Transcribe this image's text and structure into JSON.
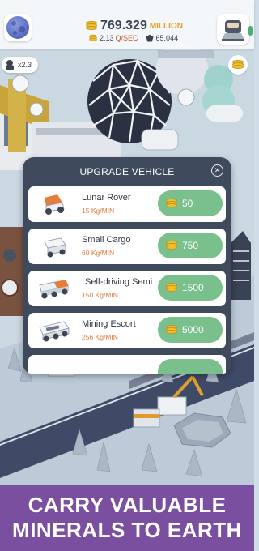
{
  "hud": {
    "money": "769.329",
    "money_unit": "MILLION",
    "rate": "2.13",
    "rate_unit": "Q/SEC",
    "minerals": "65,044",
    "multiplier": "x2.3"
  },
  "upgrade_panel": {
    "title": "UPGRADE VEHICLE",
    "close_label": "ⓧ",
    "vehicles": [
      {
        "name": "Lunar Rover",
        "rate": "15 Kg/MIN",
        "price": "50"
      },
      {
        "name": "Small Cargo",
        "rate": "60 Kg/MIN",
        "price": "750"
      },
      {
        "name": "Self-driving Semi",
        "rate": "150 Kg/MIN",
        "price": "1500"
      },
      {
        "name": "Mining Escort",
        "rate": "256 Kg/MIN",
        "price": "5000"
      }
    ]
  },
  "banner": {
    "line1": "CARRY VALUABLE",
    "line2": "MINERALS TO EARTH"
  },
  "colors": {
    "panel_bg": "#3f4b5c",
    "buy_button": "#7ac08c",
    "rate_text": "#e07a3a",
    "banner_bg": "#7a4fa0",
    "coin": "#f2c12e"
  },
  "icons": [
    "planet-icon",
    "coin-icon",
    "mineral-icon",
    "rocket-icon",
    "astronaut-icon",
    "close-icon",
    "rover-icon",
    "cargo-icon",
    "semi-icon",
    "escort-icon"
  ]
}
